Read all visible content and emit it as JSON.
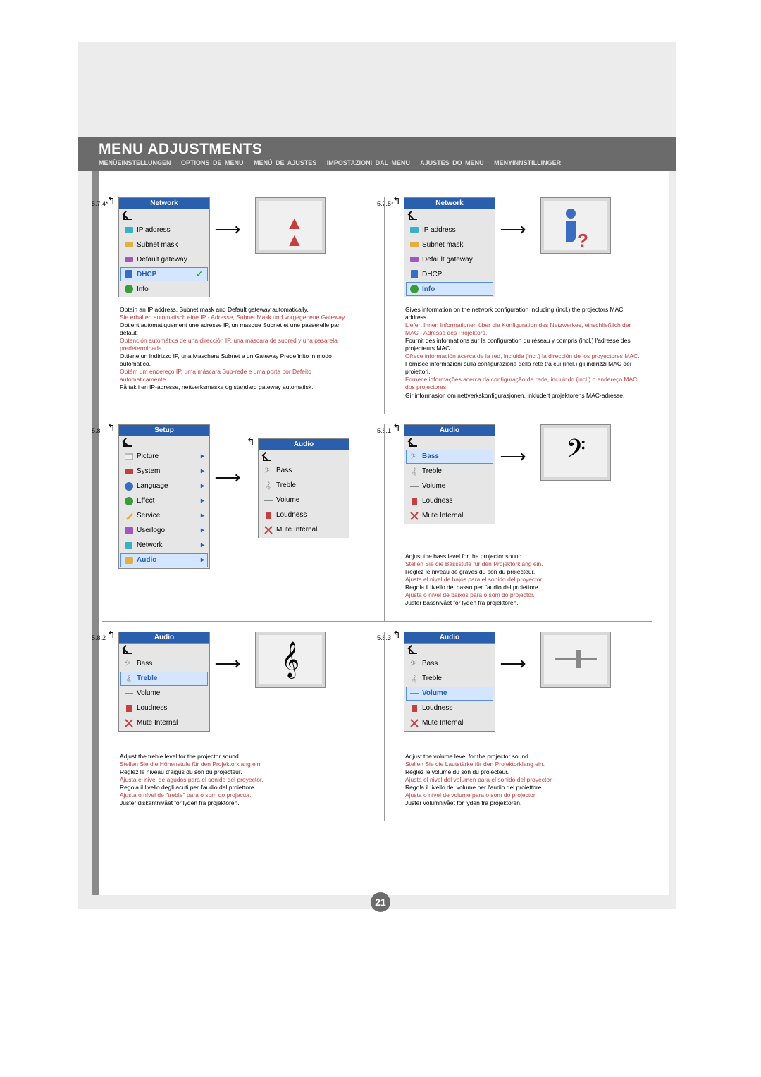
{
  "page_number": "21",
  "header": {
    "title": "MENU ADJUSTMENTS",
    "subtitles": [
      "MENÜEINSTELLUNGEN",
      "OPTIONS DE MENU",
      "MENÚ DE AJUSTES",
      "IMPOSTAZIONI DAL MENU",
      "AJUSTES DO MENU",
      "MENYINNSTILLINGER"
    ]
  },
  "s574": {
    "num": "5.7.4*",
    "menu": {
      "title": "Network",
      "items": [
        "IP address",
        "Subnet mask",
        "Default gateway",
        "DHCP",
        "Info"
      ],
      "sel": "DHCP",
      "check": true
    },
    "desc": {
      "en": "Obtain an IP address, Subnet mask and Default gateway automatically.",
      "de": "Sie erhalten automatisch eine IP - Adresse, Subnet Mask und vorgegebene Gateway.",
      "fr": "Obtient automatiquement une adresse IP, un masque Subnet et une passerelle par défaut.",
      "es": "Obtención automática de una dirección IP, una máscara de subred y una pasarela predeterminada.",
      "it": "Ottiene un Indirizzo IP, una Maschera Subnet e un Gateway Predefinito in modo automatico.",
      "pt": "Obtém um endereço IP, uma máscara Sub-rede e uma porta por Defeito automaticamente.",
      "no": "Få tak i en IP-adresse, nettverksmaske og standard gateway automatisk."
    }
  },
  "s575": {
    "num": "5.7.5*",
    "menu": {
      "title": "Network",
      "items": [
        "IP address",
        "Subnet mask",
        "Default gateway",
        "DHCP",
        "Info"
      ],
      "sel": "Info"
    },
    "desc": {
      "en": "Gives information on the network configuration including (incl.) the projectors MAC address.",
      "de": "Liefert Ihnen Informationen über die Konfiguration des Netzwerkes, einschließlich der MAC - Adresse des Projektors.",
      "fr": "Fournit des informations sur la configuration du réseau y compris (incl.) l'adresse des projecteurs MAC.",
      "es": "Ofrece información acerca de la red, incluida (incl.) la dirección de los proyectores MAC.",
      "it": "Fornisce informazioni sulla configurazione della rete tra cui (incl.) gli indirizzi MAC dei proiettori.",
      "pt": "Fornece informações acerca da configuração da rede, incluindo (incl.) o endereço MAC dos projectores.",
      "no": "Gir informasjon om nettverkskonfigurasjonen, inkludert projektorens MAC-adresse."
    }
  },
  "s58": {
    "num": "5.8",
    "menu": {
      "title": "Setup",
      "items": [
        "Picture",
        "System",
        "Language",
        "Effect",
        "Service",
        "Userlogo",
        "Network",
        "Audio"
      ],
      "sel": "Audio",
      "arrows": true
    },
    "sub": {
      "title": "Audio",
      "items": [
        "Bass",
        "Treble",
        "Volume",
        "Loudness",
        "Mute Internal"
      ]
    }
  },
  "s581": {
    "num": "5.8.1",
    "menu": {
      "title": "Audio",
      "items": [
        "Bass",
        "Treble",
        "Volume",
        "Loudness",
        "Mute Internal"
      ],
      "sel": "Bass"
    },
    "desc": {
      "en": "Adjust the bass level for the projector sound.",
      "de": "Stellen Sie die Bassstufe für den Projektorklang ein.",
      "fr": "Réglez le niveau de graves du son du projecteur.",
      "es": "Ajusta el nivel de bajos para el sonido del proyector.",
      "it": "Regola il livello del basso per l'audio del proiettore.",
      "pt": "Ajusta o nível de baixos para o som do projector.",
      "no": "Juster bassnivået for lyden fra projektoren."
    }
  },
  "s582": {
    "num": "5.8.2",
    "menu": {
      "title": "Audio",
      "items": [
        "Bass",
        "Treble",
        "Volume",
        "Loudness",
        "Mute Internal"
      ],
      "sel": "Treble"
    },
    "desc": {
      "en": "Adjust the treble level for the projector sound.",
      "de": "Stellen Sie die  Höhenstufe für den Projektorklang ein.",
      "fr": "Réglez le niveau d'aigus du son du projecteur.",
      "es": "Ajusta el nivel de agudos para el sonido del proyector.",
      "it": "Regola il livello degli acuti per l'audio del proiettore.",
      "pt": "Ajusta o nível de \"treble\" para o som do projector.",
      "no": "Juster diskantnivået for lyden fra projektoren."
    }
  },
  "s583": {
    "num": "5.8.3",
    "menu": {
      "title": "Audio",
      "items": [
        "Bass",
        "Treble",
        "Volume",
        "Loudness",
        "Mute Internal"
      ],
      "sel": "Volume"
    },
    "desc": {
      "en": "Adjust the volume level for the projector sound.",
      "de": "Stellen Sie die Lautstärke für den Projektorklang ein.",
      "fr": "Réglez le volume du son du projecteur.",
      "es": "Ajusta el nivel del volumen para el sonido del proyector.",
      "it": "Regola il livello del volume per l'audio del proiettore.",
      "pt": "Ajusta o nível de volume para o som do projector.",
      "no": "Juster volumnivået for lyden fra projektoren."
    }
  }
}
